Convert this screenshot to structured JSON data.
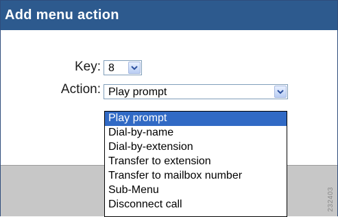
{
  "dialog": {
    "title": "Add menu action"
  },
  "form": {
    "key_label": "Key:",
    "key_value": "8",
    "action_label": "Action:",
    "action_value": "Play prompt"
  },
  "action_options": [
    {
      "label": "Play prompt",
      "selected": true
    },
    {
      "label": "Dial-by-name",
      "selected": false
    },
    {
      "label": "Dial-by-extension",
      "selected": false
    },
    {
      "label": "Transfer to extension",
      "selected": false
    },
    {
      "label": "Transfer to mailbox number",
      "selected": false
    },
    {
      "label": "Sub-Menu",
      "selected": false
    },
    {
      "label": "Disconnect call",
      "selected": false
    }
  ],
  "figure_id": "232403",
  "icons": {
    "dropdown_arrow": "chevron-down-icon"
  },
  "colors": {
    "title_bar": "#2d5a8e",
    "selected_item": "#316ac5",
    "footer": "#c7c7c7"
  }
}
